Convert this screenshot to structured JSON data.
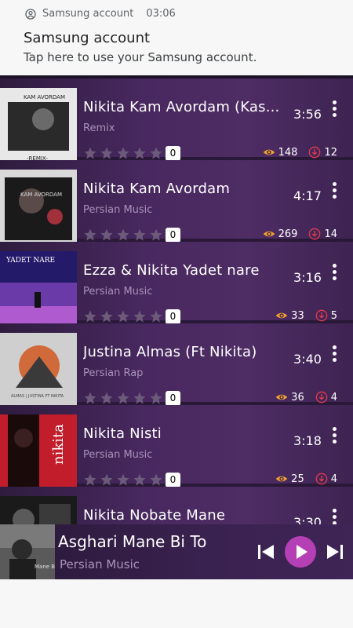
{
  "notification": {
    "app_name": "Samsung account",
    "time": "03:06",
    "title": "Samsung account",
    "body": "Tap here to use your Samsung account."
  },
  "songs": [
    {
      "title": "Nikita Kam Avordam (Kas...",
      "genre": "Remix",
      "duration": "3:56",
      "rating": "0",
      "views": "148",
      "downloads": "12"
    },
    {
      "title": "Nikita Kam Avordam",
      "genre": "Persian Music",
      "duration": "4:17",
      "rating": "0",
      "views": "269",
      "downloads": "14"
    },
    {
      "title": "Ezza & Nikita Yadet nare",
      "genre": "Persian Music",
      "duration": "3:16",
      "rating": "0",
      "views": "33",
      "downloads": "5"
    },
    {
      "title": "Justina Almas (Ft Nikita)",
      "genre": "Persian Rap",
      "duration": "3:40",
      "rating": "0",
      "views": "36",
      "downloads": "4"
    },
    {
      "title": "Nikita Nisti",
      "genre": "Persian Music",
      "duration": "3:18",
      "rating": "0",
      "views": "25",
      "downloads": "4"
    },
    {
      "title": "Nikita Nobate Mane",
      "genre": "",
      "duration": "3:30",
      "rating": "",
      "views": "",
      "downloads": ""
    }
  ],
  "player": {
    "title": "Asghari Mane Bi To",
    "genre": "Persian Music"
  },
  "colors": {
    "accent": "#b540b5",
    "views_icon": "#f0a030",
    "downloads_icon": "#e23a4a",
    "list_bg": "#40245a"
  },
  "icons": {
    "account": "account-circle-icon",
    "star": "star-icon",
    "views": "eye-icon",
    "downloads": "download-icon",
    "more": "more-vert-icon",
    "prev": "skip-previous-icon",
    "play": "play-icon",
    "next": "skip-next-icon"
  }
}
